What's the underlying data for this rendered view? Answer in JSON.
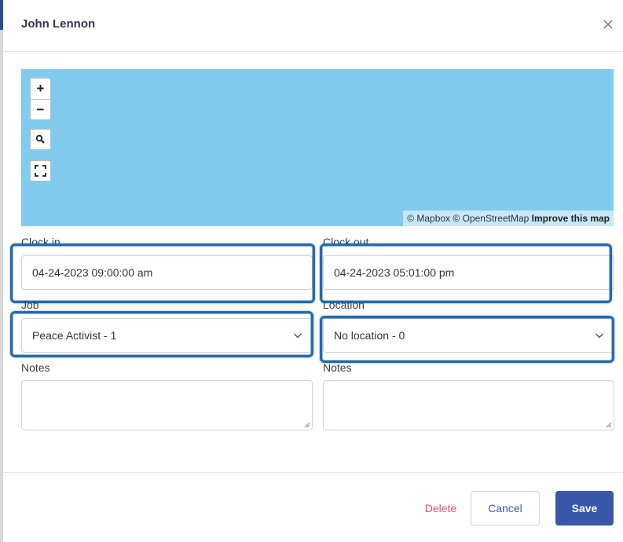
{
  "modal": {
    "title": "John Lennon"
  },
  "map": {
    "zoom_in": "+",
    "zoom_out": "−",
    "attribution_mapbox": "© Mapbox",
    "attribution_osm": "© OpenStreetMap",
    "attribution_improve": "Improve this map"
  },
  "form": {
    "clock_in_label": "Clock in",
    "clock_in_value": "04-24-2023 09:00:00 am",
    "clock_out_label": "Clock out",
    "clock_out_value": "04-24-2023 05:01:00 pm",
    "job_label": "Job",
    "job_value": "Peace Activist - 1",
    "location_label": "Location",
    "location_value": "No location - 0",
    "notes_left_label": "Notes",
    "notes_right_label": "Notes"
  },
  "footer": {
    "delete_label": "Delete",
    "cancel_label": "Cancel",
    "save_label": "Save"
  },
  "colors": {
    "map_water": "#81ccee",
    "highlight": "#1e6db3",
    "save_bg": "#3a56a8",
    "delete_text": "#e34e6e"
  },
  "icons": [
    "close-icon",
    "plus-icon",
    "minus-icon",
    "search-icon",
    "fullscreen-icon",
    "chevron-down-icon",
    "resize-grip-icon"
  ]
}
